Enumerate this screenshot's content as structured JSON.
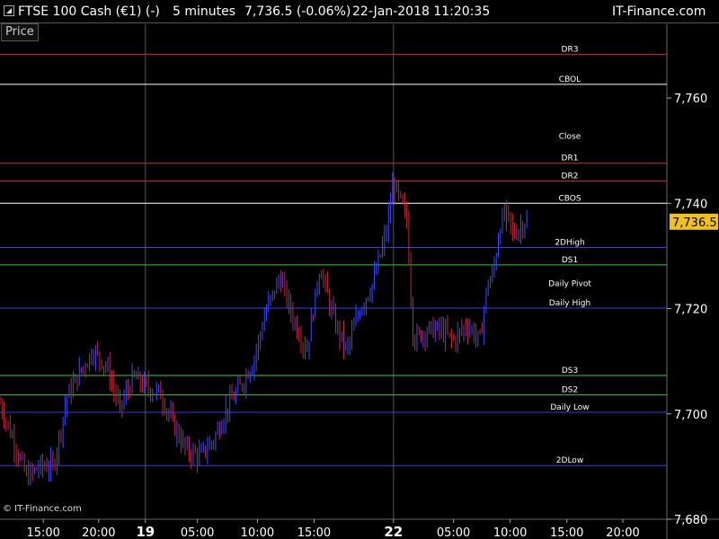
{
  "header": {
    "instrument": "FTSE 100 Cash (€1) (-)",
    "timeframe": "5 minutes",
    "last_change": "7,736.5 (-0.06%)",
    "datetime": "22-Jan-2018 11:20:35",
    "brand": "IT-Finance.com"
  },
  "panel_label": "Price",
  "copyright": "© IT-Finance.com",
  "colors": {
    "red_level": "#c83232",
    "white_level": "#ffffff",
    "blue_level": "#3c3cdc",
    "green_level": "#3cc83c",
    "up_candle": "#3c4cff",
    "down_candle": "#c8283c"
  },
  "chart_data": {
    "type": "candlestick",
    "ylim": [
      7680,
      7774
    ],
    "y_ticks": [
      {
        "value": 7680,
        "label": "7,680"
      },
      {
        "value": 7700,
        "label": "7,700"
      },
      {
        "value": 7720,
        "label": "7,720"
      },
      {
        "value": 7740,
        "label": "7,740"
      },
      {
        "value": 7760,
        "label": "7,760"
      }
    ],
    "x_ticks": [
      {
        "pos": 0.065,
        "label": "15:00",
        "bold": false
      },
      {
        "pos": 0.148,
        "label": "20:00",
        "bold": false
      },
      {
        "pos": 0.218,
        "label": "19",
        "bold": true
      },
      {
        "pos": 0.296,
        "label": "05:00",
        "bold": false
      },
      {
        "pos": 0.386,
        "label": "10:00",
        "bold": false
      },
      {
        "pos": 0.471,
        "label": "15:00",
        "bold": false
      },
      {
        "pos": 0.59,
        "label": "22",
        "bold": true
      },
      {
        "pos": 0.68,
        "label": "05:00",
        "bold": false
      },
      {
        "pos": 0.765,
        "label": "10:00",
        "bold": false
      },
      {
        "pos": 0.85,
        "label": "15:00",
        "bold": false
      },
      {
        "pos": 0.934,
        "label": "20:00",
        "bold": false
      }
    ],
    "day_separators": [
      0.218,
      0.59
    ],
    "last_price": {
      "value": 7736.5,
      "label": "7,736.5"
    },
    "levels": [
      {
        "name": "DR3",
        "value": 7768.3,
        "color": "red"
      },
      {
        "name": "CBOL",
        "value": 7762.6,
        "color": "white"
      },
      {
        "name": "Close",
        "value": null,
        "color": "none",
        "label_value": 7751.7
      },
      {
        "name": "DR1",
        "value": 7747.6,
        "color": "red"
      },
      {
        "name": "DR2",
        "value": 7744.2,
        "color": "red"
      },
      {
        "name": "CBOS",
        "value": 7740.0,
        "color": "white"
      },
      {
        "name": "2DHigh",
        "value": 7731.6,
        "color": "blue"
      },
      {
        "name": "DS1",
        "value": 7728.3,
        "color": "green"
      },
      {
        "name": "Daily Pivot",
        "value": 7723.8,
        "color": "none"
      },
      {
        "name": "Daily High",
        "value": 7720.1,
        "color": "blue"
      },
      {
        "name": "DS3",
        "value": 7707.3,
        "color": "green"
      },
      {
        "name": "DS2",
        "value": 7703.6,
        "color": "green"
      },
      {
        "name": "Daily Low",
        "value": 7700.3,
        "color": "blue"
      },
      {
        "name": "2DLow",
        "value": 7690.2,
        "color": "blue"
      }
    ],
    "price_path": [
      [
        0.0,
        7702
      ],
      [
        0.02,
        7695
      ],
      [
        0.04,
        7688
      ],
      [
        0.06,
        7690
      ],
      [
        0.08,
        7690
      ],
      [
        0.1,
        7703
      ],
      [
        0.12,
        7708
      ],
      [
        0.14,
        7712
      ],
      [
        0.16,
        7709
      ],
      [
        0.18,
        7701
      ],
      [
        0.2,
        7707
      ],
      [
        0.22,
        7705
      ],
      [
        0.24,
        7704
      ],
      [
        0.26,
        7698
      ],
      [
        0.28,
        7693
      ],
      [
        0.3,
        7692
      ],
      [
        0.32,
        7695
      ],
      [
        0.34,
        7701
      ],
      [
        0.36,
        7705
      ],
      [
        0.38,
        7710
      ],
      [
        0.4,
        7720
      ],
      [
        0.42,
        7726
      ],
      [
        0.44,
        7718
      ],
      [
        0.46,
        7712
      ],
      [
        0.48,
        7728
      ],
      [
        0.5,
        7718
      ],
      [
        0.52,
        7712
      ],
      [
        0.54,
        7720
      ],
      [
        0.56,
        7725
      ],
      [
        0.58,
        7735
      ],
      [
        0.59,
        7744
      ],
      [
        0.61,
        7737
      ],
      [
        0.62,
        7714
      ],
      [
        0.64,
        7716
      ],
      [
        0.66,
        7716
      ],
      [
        0.68,
        7714
      ],
      [
        0.7,
        7717
      ],
      [
        0.72,
        7714
      ],
      [
        0.73,
        7724
      ],
      [
        0.74,
        7727
      ],
      [
        0.75,
        7736
      ],
      [
        0.76,
        7738
      ],
      [
        0.77,
        7734
      ],
      [
        0.79,
        7737
      ]
    ]
  }
}
